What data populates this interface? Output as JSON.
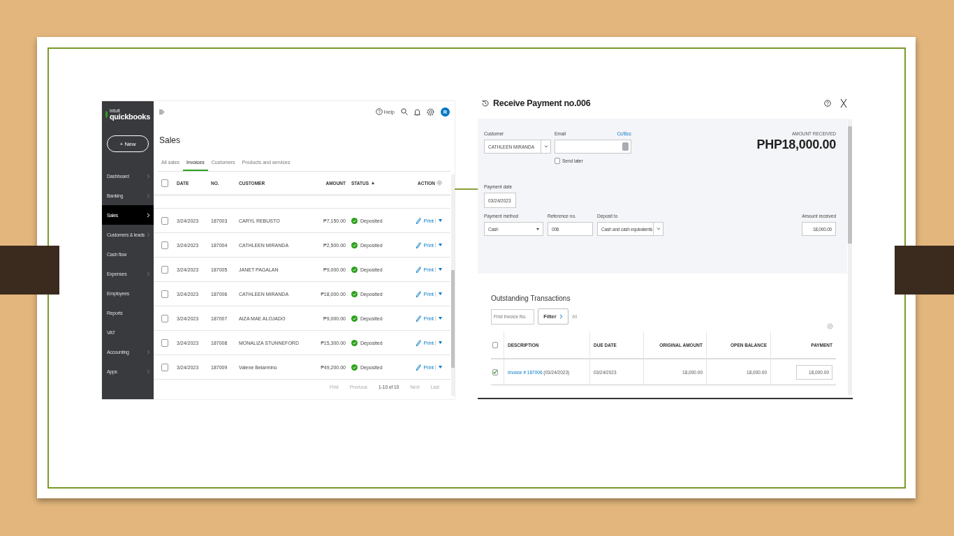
{
  "sales_screen": {
    "sidebar": {
      "logo_brand": "intuit",
      "logo": "quickbooks",
      "new_button": "+ New",
      "items": [
        {
          "label": "Dashboard",
          "selected": false,
          "expandable": true
        },
        {
          "label": "Banking",
          "selected": false,
          "expandable": true
        },
        {
          "label": "Sales",
          "selected": true,
          "expandable": true
        },
        {
          "label": "Customers & leads",
          "selected": false,
          "expandable": true
        },
        {
          "label": "Cash flow",
          "selected": false,
          "expandable": false
        },
        {
          "label": "Expenses",
          "selected": false,
          "expandable": true
        },
        {
          "label": "Employees",
          "selected": false,
          "expandable": false
        },
        {
          "label": "Reports",
          "selected": false,
          "expandable": false
        },
        {
          "label": "VAT",
          "selected": false,
          "expandable": false
        },
        {
          "label": "Accounting",
          "selected": false,
          "expandable": true
        },
        {
          "label": "Apps",
          "selected": false,
          "expandable": true
        }
      ]
    },
    "topbar": {
      "help": "Help",
      "avatar": "R"
    },
    "title": "Sales",
    "tabs": [
      {
        "label": "All sales",
        "selected": false
      },
      {
        "label": "Invoices",
        "selected": true
      },
      {
        "label": "Customers",
        "selected": false
      },
      {
        "label": "Products and services",
        "selected": false
      }
    ],
    "table": {
      "select_all_checked": false,
      "columns": [
        "DATE",
        "NO.",
        "CUSTOMER",
        "AMOUNT",
        "STATUS",
        "ACTION"
      ],
      "rows": [
        {
          "checked": false,
          "date": "3/24/2023",
          "no": "187003",
          "customer": "CARYL REBUSTO",
          "amount": "₱7,150.00",
          "status": "Deposited",
          "action": "Print"
        },
        {
          "checked": false,
          "date": "3/24/2023",
          "no": "187004",
          "customer": "CATHLEEN MIRANDA",
          "amount": "₱2,500.00",
          "status": "Deposited",
          "action": "Print"
        },
        {
          "checked": false,
          "date": "3/24/2023",
          "no": "187005",
          "customer": "JANET PAGALAN",
          "amount": "₱9,000.00",
          "status": "Deposited",
          "action": "Print"
        },
        {
          "checked": false,
          "date": "3/24/2023",
          "no": "187006",
          "customer": "CATHLEEN MIRANDA",
          "amount": "₱18,000.00",
          "status": "Deposited",
          "action": "Print"
        },
        {
          "checked": false,
          "date": "3/24/2023",
          "no": "187007",
          "customer": "AIZA MAE ALOJADO",
          "amount": "₱9,000.00",
          "status": "Deposited",
          "action": "Print"
        },
        {
          "checked": false,
          "date": "3/24/2023",
          "no": "187008",
          "customer": "MONALIZA STUNNEFORD",
          "amount": "₱15,300.00",
          "status": "Deposited",
          "action": "Print"
        },
        {
          "checked": false,
          "date": "3/24/2023",
          "no": "187009",
          "customer": "Valene Belarmino",
          "amount": "₱49,200.00",
          "status": "Deposited",
          "action": "Print"
        }
      ]
    },
    "pager": {
      "first": "First",
      "previous": "Previous",
      "range": "1-10 of 10",
      "next": "Next",
      "last": "Last"
    }
  },
  "payment_screen": {
    "title": "Receive Payment no.006",
    "customer": {
      "label": "Customer",
      "value": "CATHLEEN MIRANDA"
    },
    "email": {
      "label": "Email",
      "cc_bcc": "Cc/Bcc"
    },
    "send_later": {
      "label": "Send later",
      "checked": false
    },
    "amount_received_label": "AMOUNT RECEIVED",
    "amount_received_total": "PHP18,000.00",
    "payment_date": {
      "label": "Payment date",
      "value": "03/24/2023"
    },
    "payment_method": {
      "label": "Payment method",
      "value": "Cash"
    },
    "reference_no": {
      "label": "Reference no.",
      "value": "006"
    },
    "deposit_to": {
      "label": "Deposit to",
      "value": "Cash and cash equivalents"
    },
    "amount_received": {
      "label": "Amount received",
      "value": "18,000.00"
    },
    "outstanding": {
      "title": "Outstanding Transactions",
      "find_placeholder": "Find Invoice No.",
      "filter_button": "Filter",
      "all": "All",
      "select_all_checked": false,
      "columns": [
        "DESCRIPTION",
        "DUE DATE",
        "ORIGINAL AMOUNT",
        "OPEN BALANCE",
        "PAYMENT"
      ],
      "rows": [
        {
          "checked": true,
          "invoice_link": "Invoice # 187006",
          "invoice_date": "(03/24/2023)",
          "due_date": "03/24/2023",
          "original_amount": "18,000.00",
          "open_balance": "18,000.00",
          "payment": "18,000.00"
        }
      ]
    }
  }
}
